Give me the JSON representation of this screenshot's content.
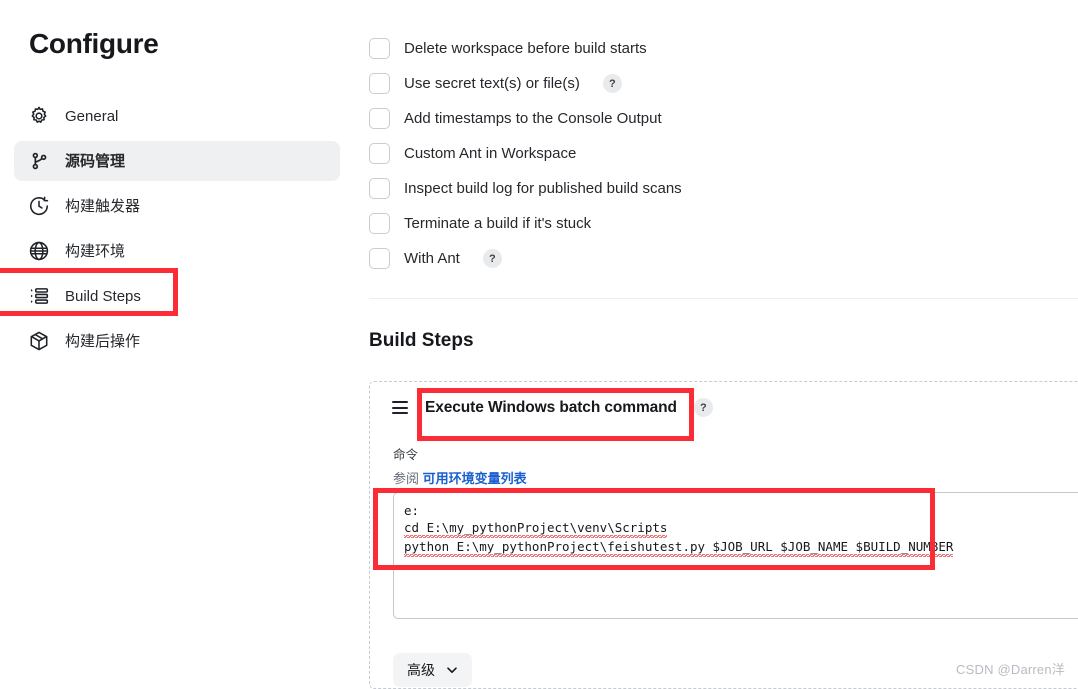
{
  "page": {
    "title": "Configure",
    "watermark": "CSDN @Darren洋"
  },
  "sidebar": {
    "items": [
      {
        "label": "General",
        "icon": "gear-icon",
        "active": false
      },
      {
        "label": "源码管理",
        "icon": "git-branch-icon",
        "active": true
      },
      {
        "label": "构建触发器",
        "icon": "clock-icon",
        "active": false
      },
      {
        "label": "构建环境",
        "icon": "globe-icon",
        "active": false
      },
      {
        "label": "Build Steps",
        "icon": "list-icon",
        "active": false
      },
      {
        "label": "构建后操作",
        "icon": "package-icon",
        "active": false
      }
    ]
  },
  "main": {
    "checkboxes": [
      {
        "label": "Delete workspace before build starts",
        "checked": false,
        "help": false
      },
      {
        "label": "Use secret text(s) or file(s)",
        "checked": false,
        "help": true
      },
      {
        "label": "Add timestamps to the Console Output",
        "checked": false,
        "help": false
      },
      {
        "label": "Custom Ant in Workspace",
        "checked": false,
        "help": false
      },
      {
        "label": "Inspect build log for published build scans",
        "checked": false,
        "help": false
      },
      {
        "label": "Terminate a build if it's stuck",
        "checked": false,
        "help": false
      },
      {
        "label": "With Ant",
        "checked": false,
        "help": true
      }
    ],
    "help_badge_label": "?",
    "build_steps": {
      "heading": "Build Steps",
      "step": {
        "drag_handle": "drag-handle-icon",
        "title": "Execute Windows batch command",
        "help_badge": "?",
        "field_label": "命令",
        "see_also_prefix": "参阅",
        "see_also_link": "可用环境变量列表",
        "command_lines": [
          {
            "text": "e:",
            "misspelled": false
          },
          {
            "text": "cd E:\\my_pythonProject\\venv\\Scripts",
            "misspelled": true
          },
          {
            "text": "python E:\\my_pythonProject\\feishutest.py $JOB_URL $JOB_NAME $BUILD_NUMBER",
            "misspelled": true
          }
        ],
        "advanced_button": "高级"
      }
    }
  },
  "annotations": {
    "accent_color": "#fb2c36",
    "boxes": [
      {
        "target": "sidebar-item-build-steps"
      },
      {
        "target": "step-title"
      },
      {
        "target": "command-textarea-text"
      }
    ]
  }
}
